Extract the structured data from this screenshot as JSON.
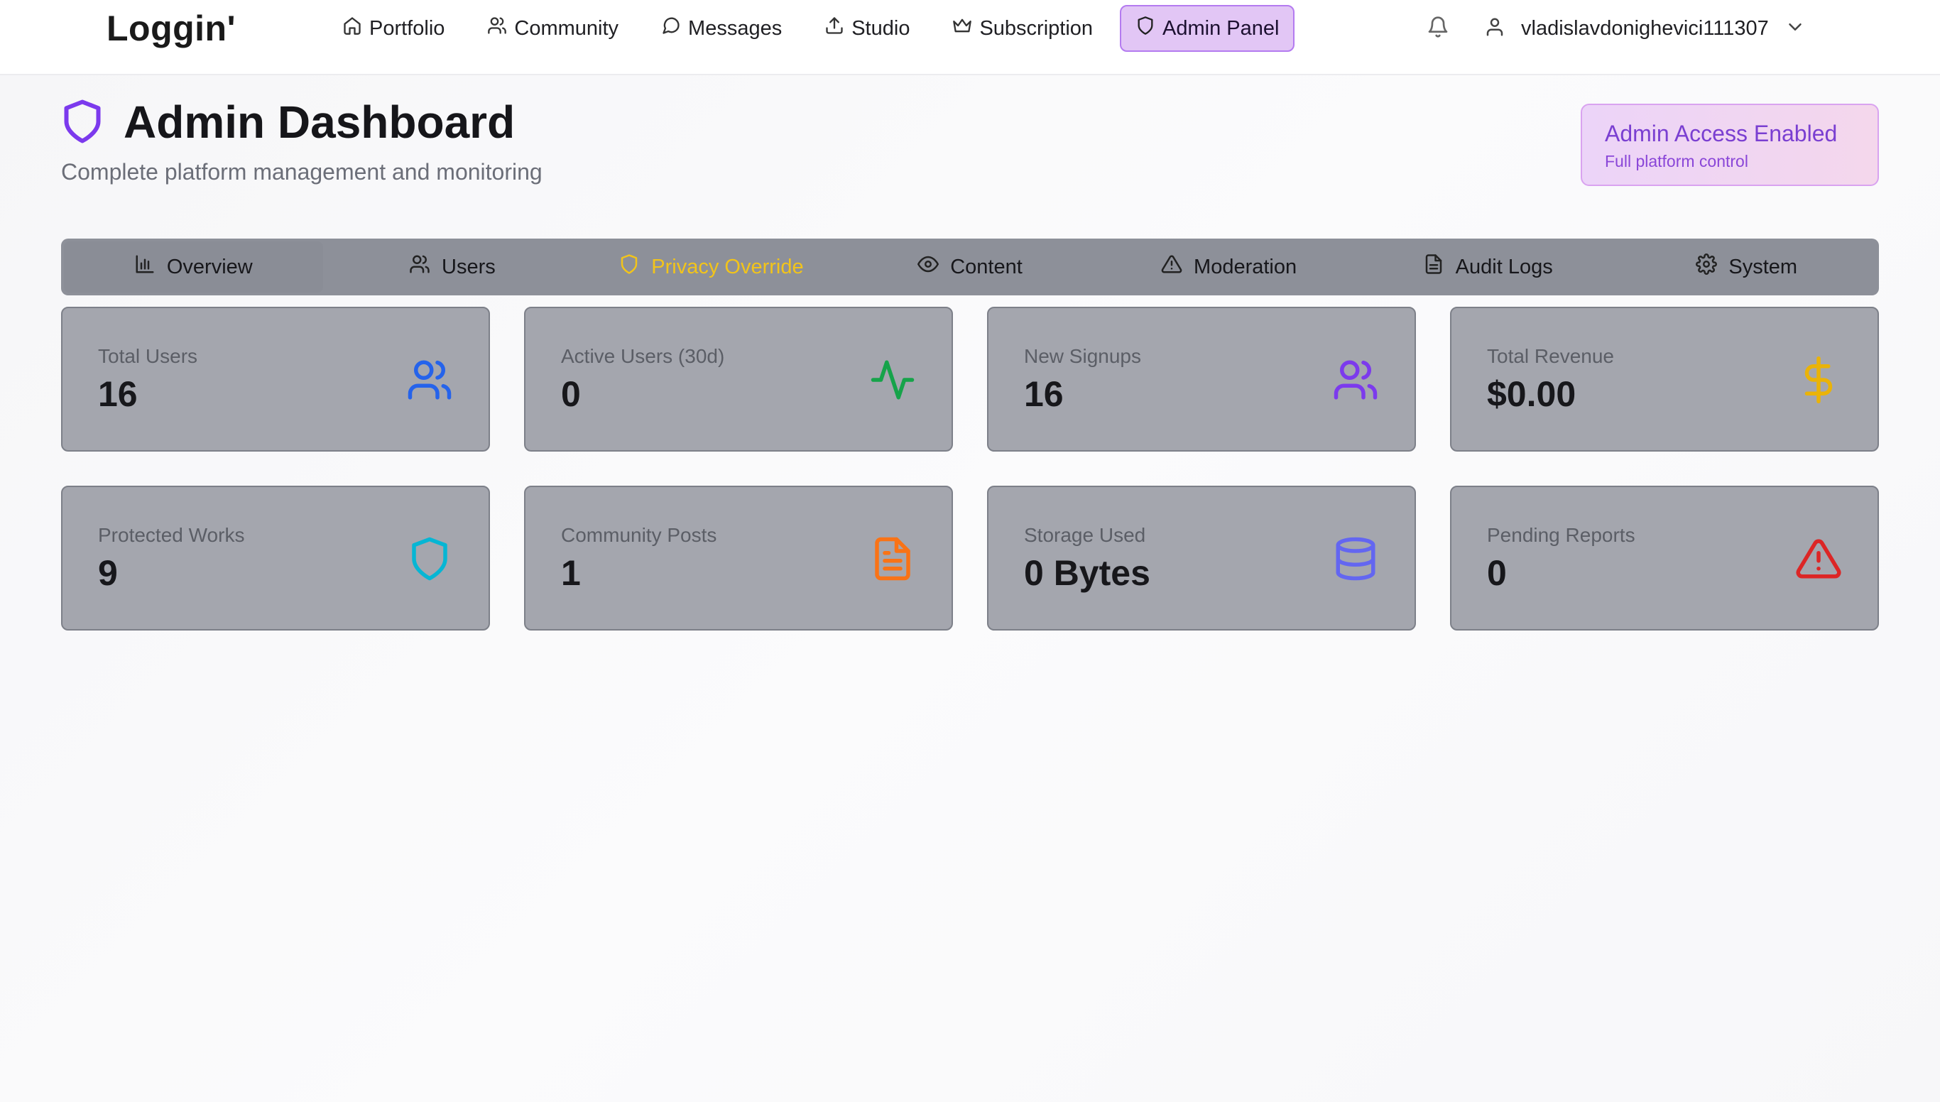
{
  "app": {
    "brand": "Loggin'"
  },
  "nav": {
    "items": [
      {
        "label": "Portfolio",
        "icon": "home-icon"
      },
      {
        "label": "Community",
        "icon": "users-icon"
      },
      {
        "label": "Messages",
        "icon": "message-circle-icon"
      },
      {
        "label": "Studio",
        "icon": "upload-icon"
      },
      {
        "label": "Subscription",
        "icon": "crown-icon"
      },
      {
        "label": "Admin Panel",
        "icon": "shield-icon",
        "active": true
      }
    ],
    "user": {
      "name": "vladislavdonighevici111307"
    }
  },
  "header": {
    "title": "Admin Dashboard",
    "subtitle": "Complete platform management and monitoring",
    "badge": {
      "title": "Admin Access Enabled",
      "subtitle": "Full platform control"
    }
  },
  "tabs": [
    {
      "label": "Overview",
      "icon": "bar-chart-icon",
      "selected": true
    },
    {
      "label": "Users",
      "icon": "users-icon"
    },
    {
      "label": "Privacy Override",
      "icon": "shield-icon",
      "highlight": true
    },
    {
      "label": "Content",
      "icon": "eye-icon"
    },
    {
      "label": "Moderation",
      "icon": "alert-triangle-icon"
    },
    {
      "label": "Audit Logs",
      "icon": "file-text-icon"
    },
    {
      "label": "System",
      "icon": "settings-icon"
    }
  ],
  "stats": [
    {
      "label": "Total Users",
      "value": "16",
      "icon": "users-icon",
      "color": "#2563eb"
    },
    {
      "label": "Active Users (30d)",
      "value": "0",
      "icon": "activity-icon",
      "color": "#16a34a"
    },
    {
      "label": "New Signups",
      "value": "16",
      "icon": "users-icon",
      "color": "#7c3aed"
    },
    {
      "label": "Total Revenue",
      "value": "$0.00",
      "icon": "dollar-icon",
      "color": "#eab308"
    },
    {
      "label": "Protected Works",
      "value": "9",
      "icon": "shield-icon",
      "color": "#06b6d4"
    },
    {
      "label": "Community Posts",
      "value": "1",
      "icon": "file-text-icon",
      "color": "#f97316"
    },
    {
      "label": "Storage Used",
      "value": "0 Bytes",
      "icon": "database-icon",
      "color": "#6366f1"
    },
    {
      "label": "Pending Reports",
      "value": "0",
      "icon": "alert-triangle-icon",
      "color": "#dc2626"
    }
  ]
}
